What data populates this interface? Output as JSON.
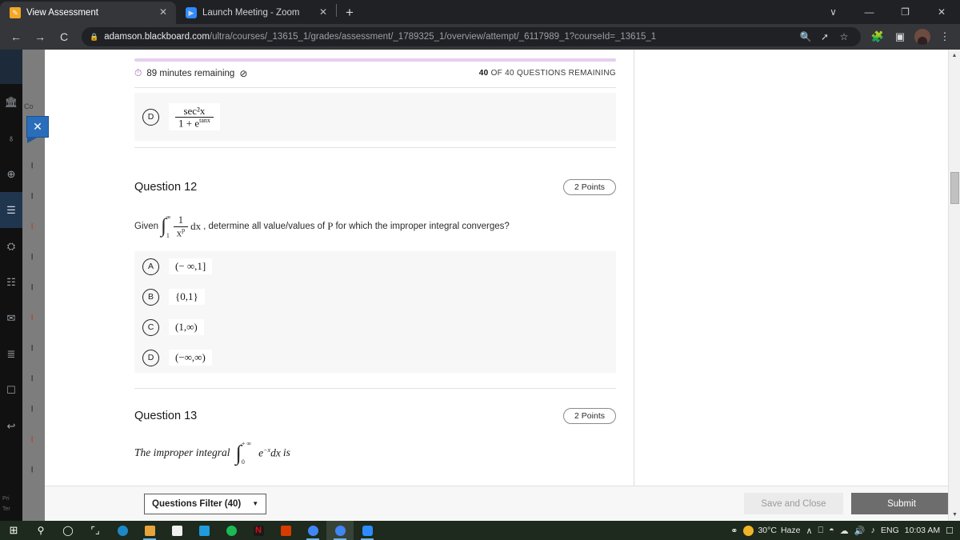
{
  "browser": {
    "tabs": [
      {
        "title": "View Assessment",
        "favicon": "pencil-icon",
        "active": true
      },
      {
        "title": "Launch Meeting - Zoom",
        "favicon": "zoom-camera-icon",
        "active": false
      }
    ],
    "new_tab_label": "+",
    "window_controls": {
      "chevron": "∨",
      "minimize": "—",
      "maximize": "❐",
      "close": "✕"
    },
    "nav": {
      "back": "←",
      "forward": "→",
      "reload": "↻"
    },
    "omnibox": {
      "lock": "🔒",
      "host": "adamson.blackboard.com",
      "path": "/ultra/courses/_13615_1/grades/assessment/_1789325_1/overview/attempt/_6117989_1?courseId=_13615_1",
      "full_url": "adamson.blackboard.com/ultra/courses/_13615_1/grades/assessment/_1789325_1/overview/attempt/_6117989_1?courseId=_13615_1"
    },
    "toolbar_icons": [
      "search-icon",
      "share-icon",
      "bookmark-star-icon",
      "extensions-puzzle-icon",
      "side-panel-icon",
      "profile-avatar",
      "chrome-menu-icon"
    ]
  },
  "assessment": {
    "timer_text": "89 minutes remaining",
    "timer_icon": "stopwatch-icon",
    "hide_timer_icon": "eye-off-icon",
    "questions_remaining_count": "40",
    "questions_remaining_text": " OF 40 QUESTIONS REMAINING",
    "previous_question_option": {
      "letter": "D",
      "numerator": "sec²x",
      "denominator_base": "1 + e",
      "denominator_exp": "tanx"
    },
    "questions": [
      {
        "title": "Question 12",
        "points": "2 Points",
        "stem_prefix": "Given",
        "integral_lower": "1",
        "integral_upper": "∞",
        "frac_num": "1",
        "frac_den": "x",
        "frac_den_exp": "p",
        "dx": "dx",
        "stem_suffix_a": ", determine all value/values of",
        "stem_var": "P",
        "stem_suffix_b": "for which the improper integral converges?",
        "options": [
          {
            "letter": "A",
            "text": "(− ∞,1]"
          },
          {
            "letter": "B",
            "text": "{0,1}"
          },
          {
            "letter": "C",
            "text": "(1,∞)"
          },
          {
            "letter": "D",
            "text": "(−∞,∞)"
          }
        ]
      },
      {
        "title": "Question 13",
        "points": "2 Points",
        "stem_prefix": "The improper integral",
        "integral_lower": "0",
        "integral_upper": "+ ∞",
        "integrand": "e",
        "integrand_exp": "−x",
        "dx": "dx",
        "stem_suffix": "is"
      }
    ],
    "footer": {
      "filter_label": "Questions Filter (40)",
      "filter_caret": "▼",
      "save_close_label": "Save and Close",
      "submit_label": "Submit"
    },
    "sidebar": {
      "course_label": "Co",
      "close_badge": "✕",
      "items": [
        {
          "name": "institution-icon",
          "glyph": "🏛"
        },
        {
          "name": "profile-icon",
          "glyph": "♁"
        },
        {
          "name": "globe-icon",
          "glyph": "⊕"
        },
        {
          "name": "courses-icon",
          "glyph": "☰",
          "selected": true
        },
        {
          "name": "organizations-icon",
          "glyph": "⛭"
        },
        {
          "name": "calendar-icon",
          "glyph": "☷"
        },
        {
          "name": "messages-icon",
          "glyph": "✉"
        },
        {
          "name": "grades-icon",
          "glyph": "≣"
        },
        {
          "name": "tools-icon",
          "glyph": "☐"
        },
        {
          "name": "signout-icon",
          "glyph": "↩"
        }
      ],
      "footer_links": [
        "Pri",
        "Ter"
      ]
    }
  },
  "taskbar": {
    "apps": [
      {
        "name": "start-button",
        "glyph": "⊞",
        "color": "#ffffff"
      },
      {
        "name": "search-icon",
        "glyph": "⚲",
        "color": "#ffffff"
      },
      {
        "name": "cortana-icon",
        "glyph": "○",
        "color": "#ffffff"
      },
      {
        "name": "task-view-icon",
        "glyph": "⧉",
        "color": "#ffffff"
      },
      {
        "name": "edge-icon",
        "glyph": "",
        "color": "#1e88c7"
      },
      {
        "name": "file-explorer-icon",
        "glyph": "",
        "color": "#e8a33d"
      },
      {
        "name": "microsoft-store-icon",
        "glyph": "",
        "color": "#f0f0f0"
      },
      {
        "name": "mail-icon",
        "glyph": "",
        "color": "#1f9bde"
      },
      {
        "name": "spotify-icon",
        "glyph": "",
        "color": "#1db954"
      },
      {
        "name": "netflix-icon",
        "glyph": "N",
        "color": "#1a1a1a"
      },
      {
        "name": "office-icon",
        "glyph": "",
        "color": "#d83b01"
      },
      {
        "name": "chrome-icon",
        "glyph": "",
        "color": "#4285f4"
      },
      {
        "name": "chrome-icon-2",
        "glyph": "",
        "color": "#4285f4"
      },
      {
        "name": "zoom-icon",
        "glyph": "",
        "color": "#2d8cff"
      }
    ],
    "tray": {
      "people_icon": "⛭",
      "weather_temp": "30°C",
      "weather_desc": "Haze",
      "chevron": "∧",
      "icons": [
        "tablet-mode-icon",
        "wifi-icon",
        "onedrive-icon",
        "volume-icon",
        "headset-icon"
      ],
      "language": "ENG",
      "clock": "10:03 AM",
      "action_center": "▢"
    }
  },
  "colors": {
    "progress_bar": "#e6cff0",
    "timer_accent": "#9b59b6",
    "submit_bg": "#6d6d6d",
    "rail_bg": "#111111",
    "close_badge": "#2a6ebb"
  }
}
